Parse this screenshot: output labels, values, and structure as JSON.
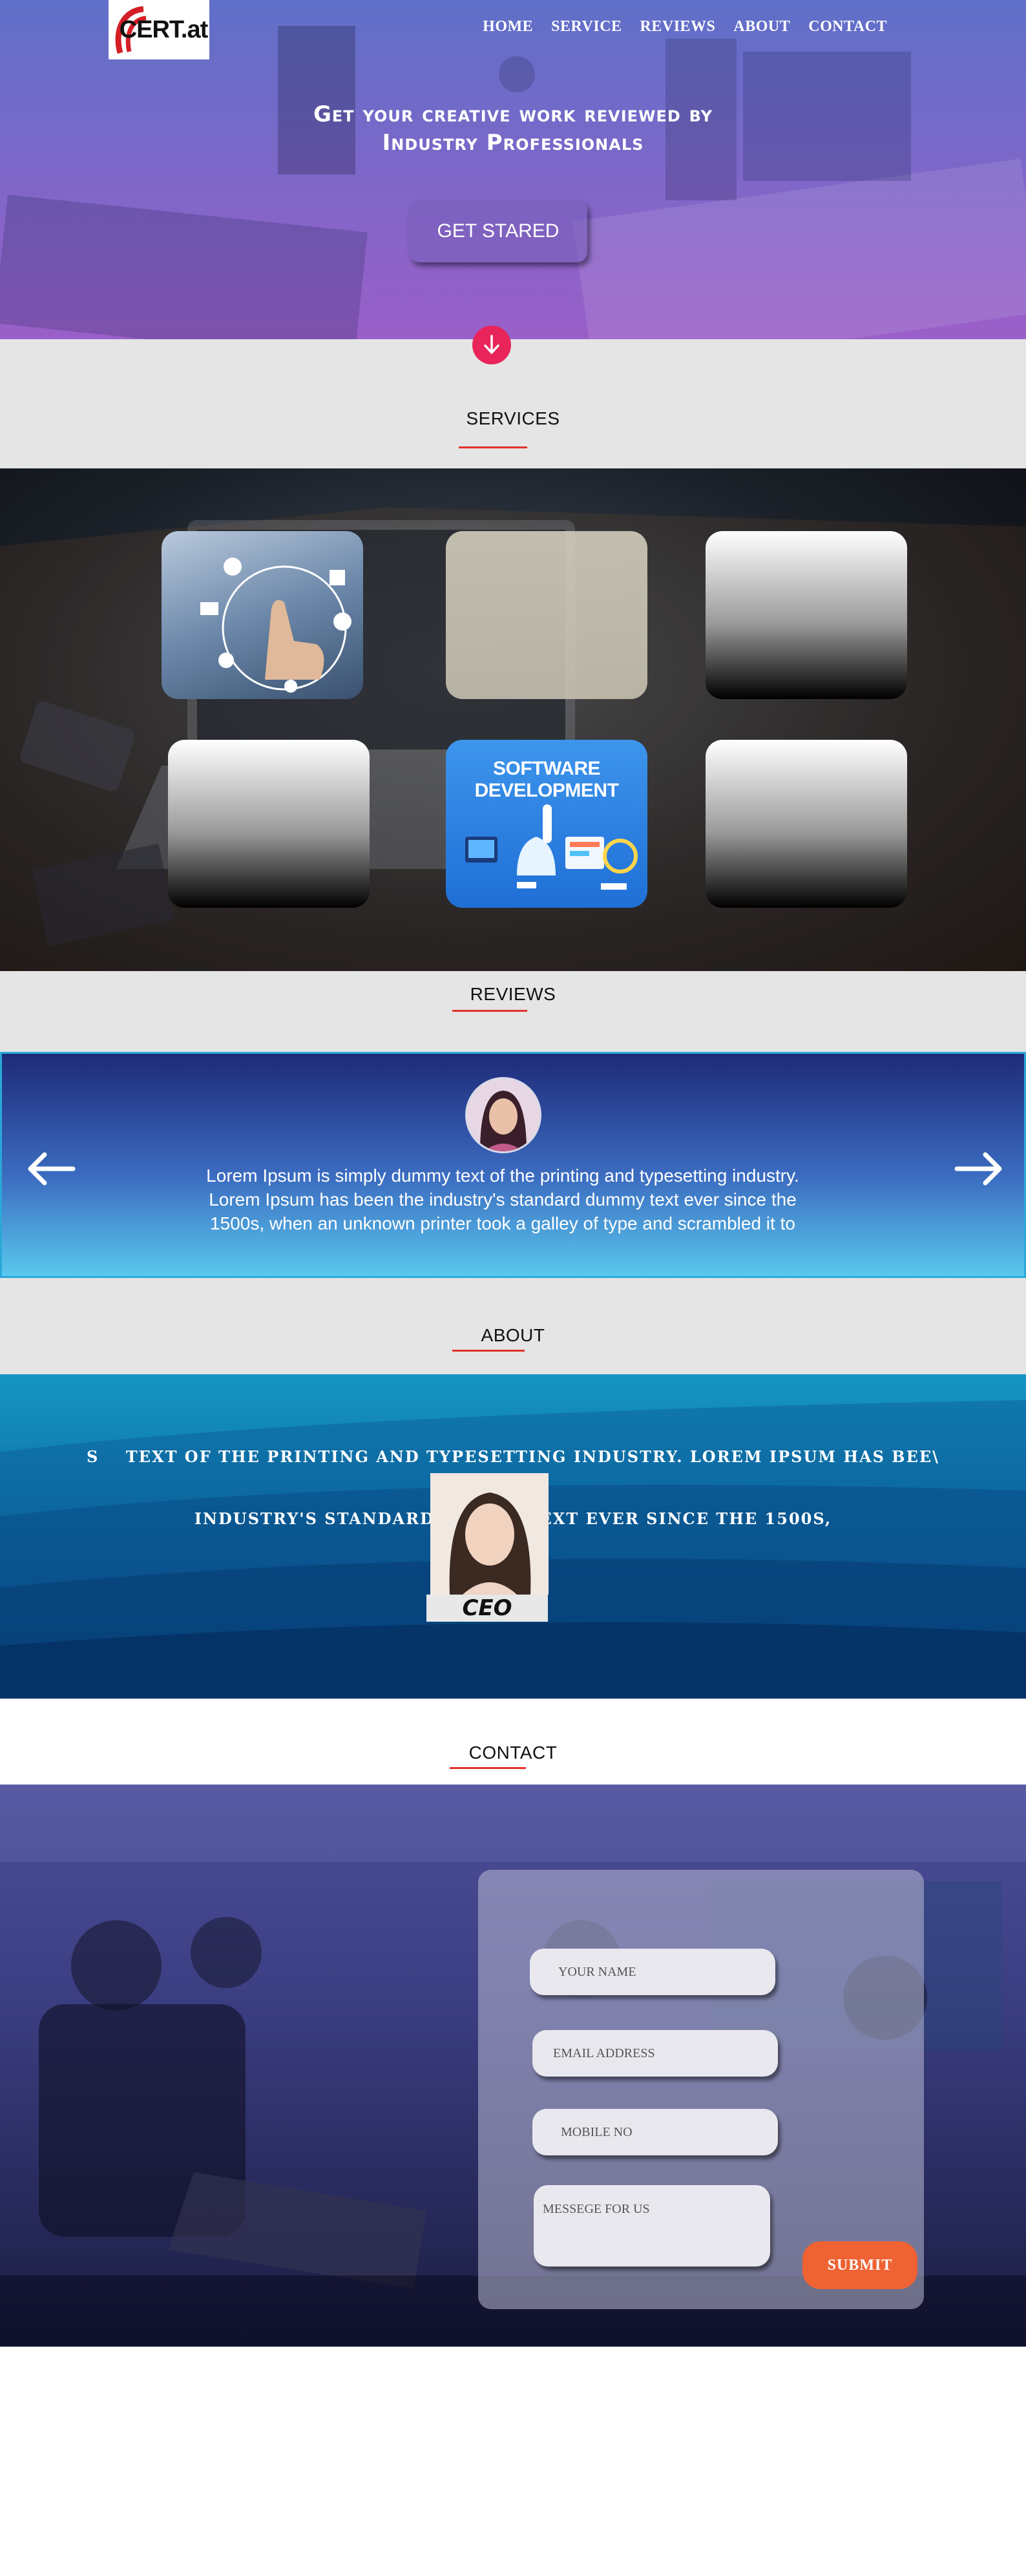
{
  "logo": {
    "text": "CERT.at"
  },
  "nav": [
    "HOME",
    "SERVICE",
    "REVIEWS",
    "ABOUT",
    "CONTACT"
  ],
  "hero": {
    "title_line1": "Get your creative work reviewed by",
    "title_line2": "Industry Professionals",
    "cta_label": "GET STARED"
  },
  "services": {
    "heading": "SERVICES",
    "tiles": [
      {
        "label": ""
      },
      {
        "label": ""
      },
      {
        "label": ""
      },
      {
        "label": ""
      },
      {
        "label": "SOFTWARE DEVELOPMENT"
      },
      {
        "label": ""
      }
    ]
  },
  "reviews": {
    "heading": "REVIEWS",
    "text": "Lorem Ipsum is simply dummy text of the printing and typesetting industry. Lorem Ipsum has been the industry's standard dummy text ever since the 1500s, when an unknown printer took a galley of type and scrambled it to"
  },
  "about": {
    "heading": "ABOUT",
    "marquee_line1": "S    TEXT OF THE PRINTING AND TYPESETTING INDUSTRY. LOREM IPSUM HAS BEE\\",
    "marquee_line2": "INDUSTRY'S STANDARD DUMMY TEXT EVER SINCE THE 1500S,",
    "ceo_caption": "CEO"
  },
  "contact": {
    "heading": "CONTACT",
    "name_placeholder": "YOUR NAME",
    "email_placeholder": "EMAIL ADDRESS",
    "mobile_placeholder": "MOBILE NO",
    "message_placeholder": "MESSEGE FOR US",
    "submit_label": "SUBMIT"
  },
  "colors": {
    "accent_red": "#e2322c",
    "down_button": "#e8245a",
    "submit": "#ef6233",
    "review_border": "#2aa8d8"
  }
}
